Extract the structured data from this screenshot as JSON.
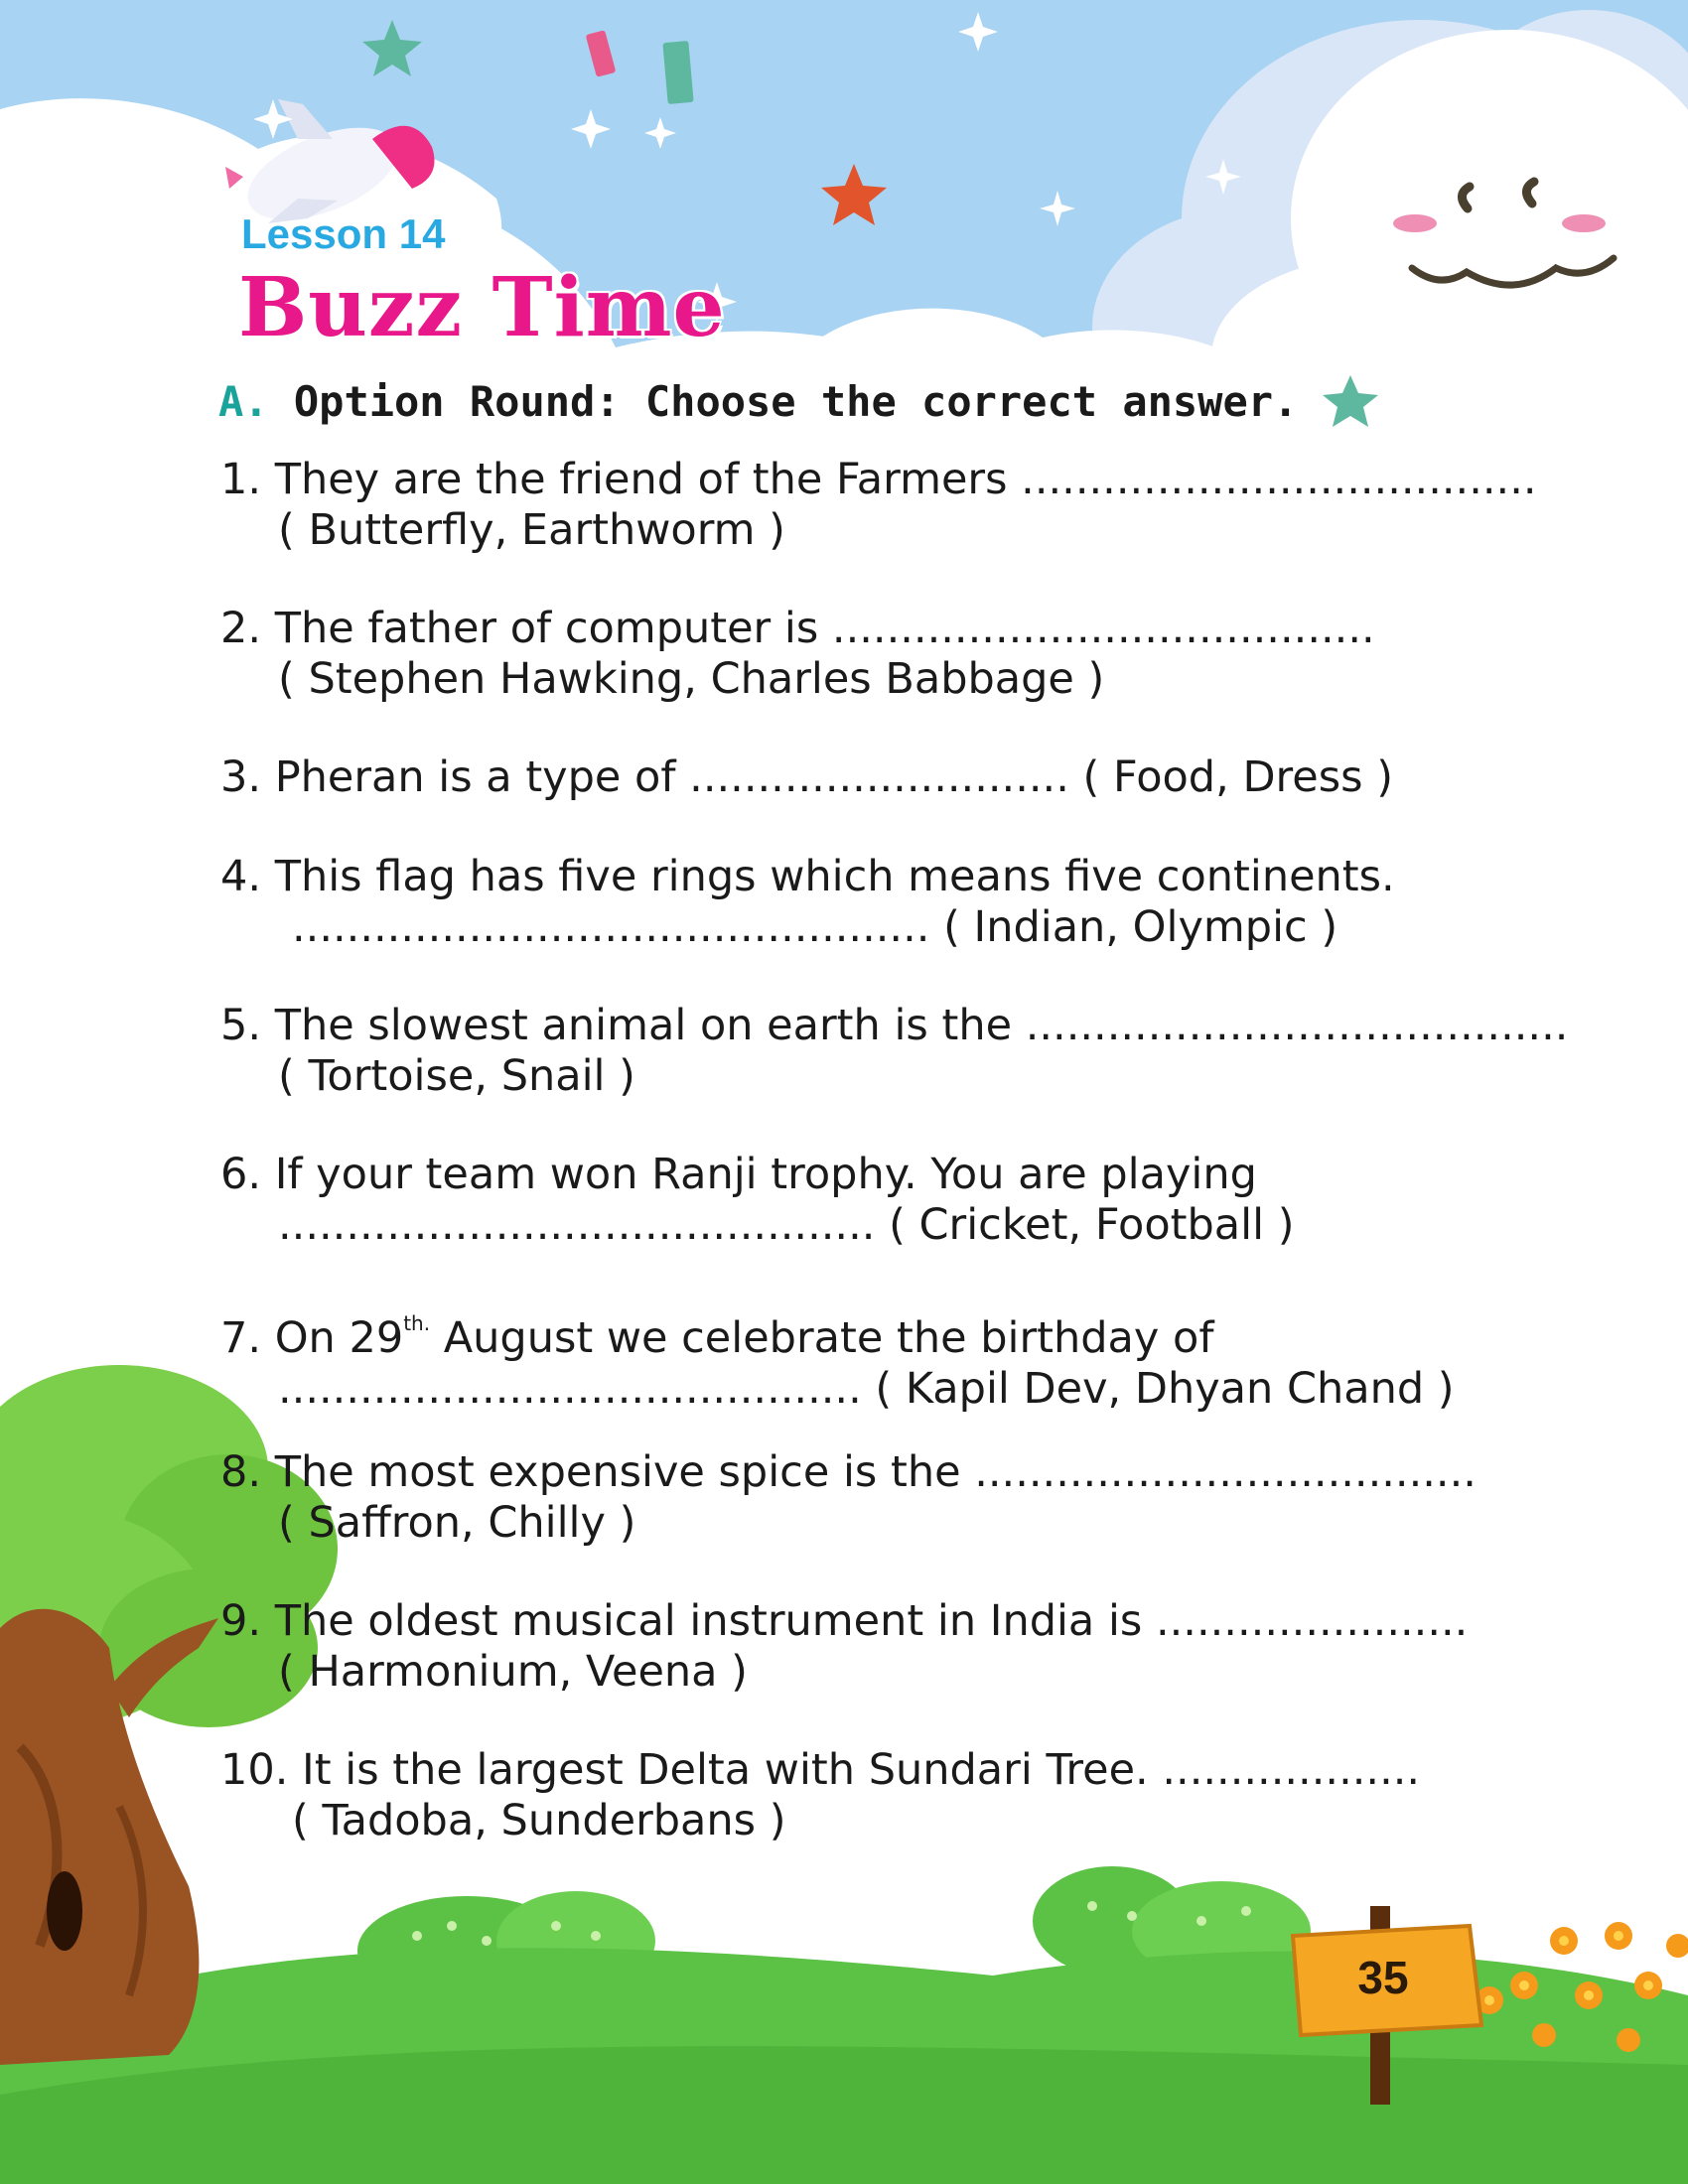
{
  "header": {
    "lesson": "Lesson 14",
    "title": "Buzz Time"
  },
  "section": {
    "letter": "A.",
    "instruction": "Option Round: Choose the correct answer."
  },
  "questions": [
    {
      "line1": "1. They are the friend of the Farmers ......................................",
      "line2": "( Butterfly, Earthworm )"
    },
    {
      "line1": "2. The father of computer is ........................................",
      "line2": "( Stephen Hawking, Charles Babbage )"
    },
    {
      "line1": "3.  Pheran is a type of ............................ ( Food, Dress )",
      "line2": ""
    },
    {
      "line1": "4. This flag has five rings which means five continents.",
      "line2": "............................................... ( Indian, Olympic )"
    },
    {
      "line1": "5. The slowest animal on earth is the ........................................",
      "line2": "( Tortoise, Snail )"
    },
    {
      "line1": "6. If your team won Ranji trophy. You are playing",
      "line2": "............................................ ( Cricket, Football )"
    },
    {
      "line1_pre": "7. On 29",
      "line1_sup": "th.",
      "line1_post": " August we celebrate the birthday of",
      "line2": "........................................... ( Kapil Dev, Dhyan Chand )"
    },
    {
      "line1": "8. The most expensive spice is the .....................................",
      "line2": "( Saffron, Chilly )"
    },
    {
      "line1": "9. The oldest musical instrument in India is .......................",
      "line2": "( Harmonium, Veena )"
    },
    {
      "line1": "10. It is the largest Delta with Sundari Tree. ...................",
      "line2": "( Tadoba, Sunderbans )"
    }
  ],
  "page_number": "35",
  "colors": {
    "sky": "#a9d3f2",
    "title_pink": "#e8178a",
    "lesson_blue": "#29a9e1",
    "section_teal": "#1aa39a",
    "grass": "#5cc246",
    "sign_orange": "#f5a623"
  }
}
